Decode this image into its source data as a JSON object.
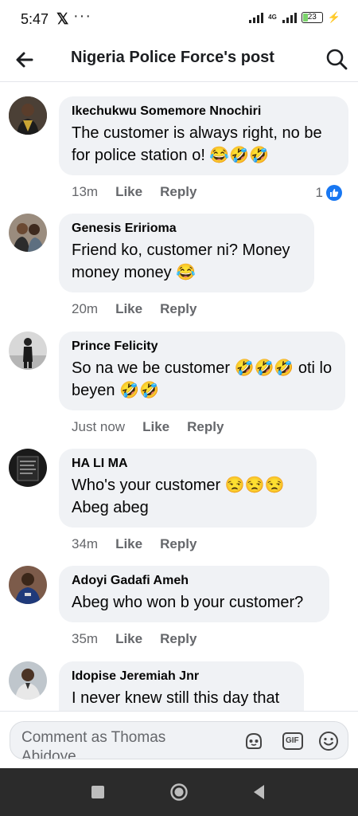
{
  "status_bar": {
    "time": "5:47",
    "x_logo": "𝕏",
    "dots": "···",
    "network": "4G",
    "battery": "23",
    "battery_level_percent": 23
  },
  "header": {
    "title": "Nigeria Police Force's post",
    "back_icon": "arrow-left-icon",
    "search_icon": "search-icon"
  },
  "comments": [
    {
      "name": "Ikechukwu Somemore Nnochiri",
      "text": "The customer is always right, no be for police station o! 😂🤣🤣",
      "time": "13m",
      "like": "Like",
      "reply": "Reply",
      "reactions": "1"
    },
    {
      "name": "Genesis Eririoma",
      "text": "Friend ko, customer ni? Money money money 😂",
      "time": "20m",
      "like": "Like",
      "reply": "Reply"
    },
    {
      "name": "Prince Felicity",
      "text": "So na we be customer 🤣🤣🤣 oti lo beyen 🤣🤣",
      "time": "Just now",
      "like": "Like",
      "reply": "Reply"
    },
    {
      "name": "HA LI MA",
      "text": "Who's your customer 😒😒😒 Abeg abeg",
      "time": "34m",
      "like": "Like",
      "reply": "Reply"
    },
    {
      "name": "Adoyi Gadafi Ameh",
      "text": "Abeg who won b your customer?",
      "time": "35m",
      "like": "Like",
      "reply": "Reply"
    },
    {
      "name": "Idopise Jeremiah Jnr",
      "text": "I never knew still this day that"
    }
  ],
  "composer": {
    "placeholder": "Comment as Thomas Abidoye",
    "gif_label": "GIF"
  },
  "colors": {
    "accent": "#1877f2",
    "bubble": "#f0f2f5",
    "meta_text": "#65676b",
    "navbar": "#2b2b2b"
  }
}
